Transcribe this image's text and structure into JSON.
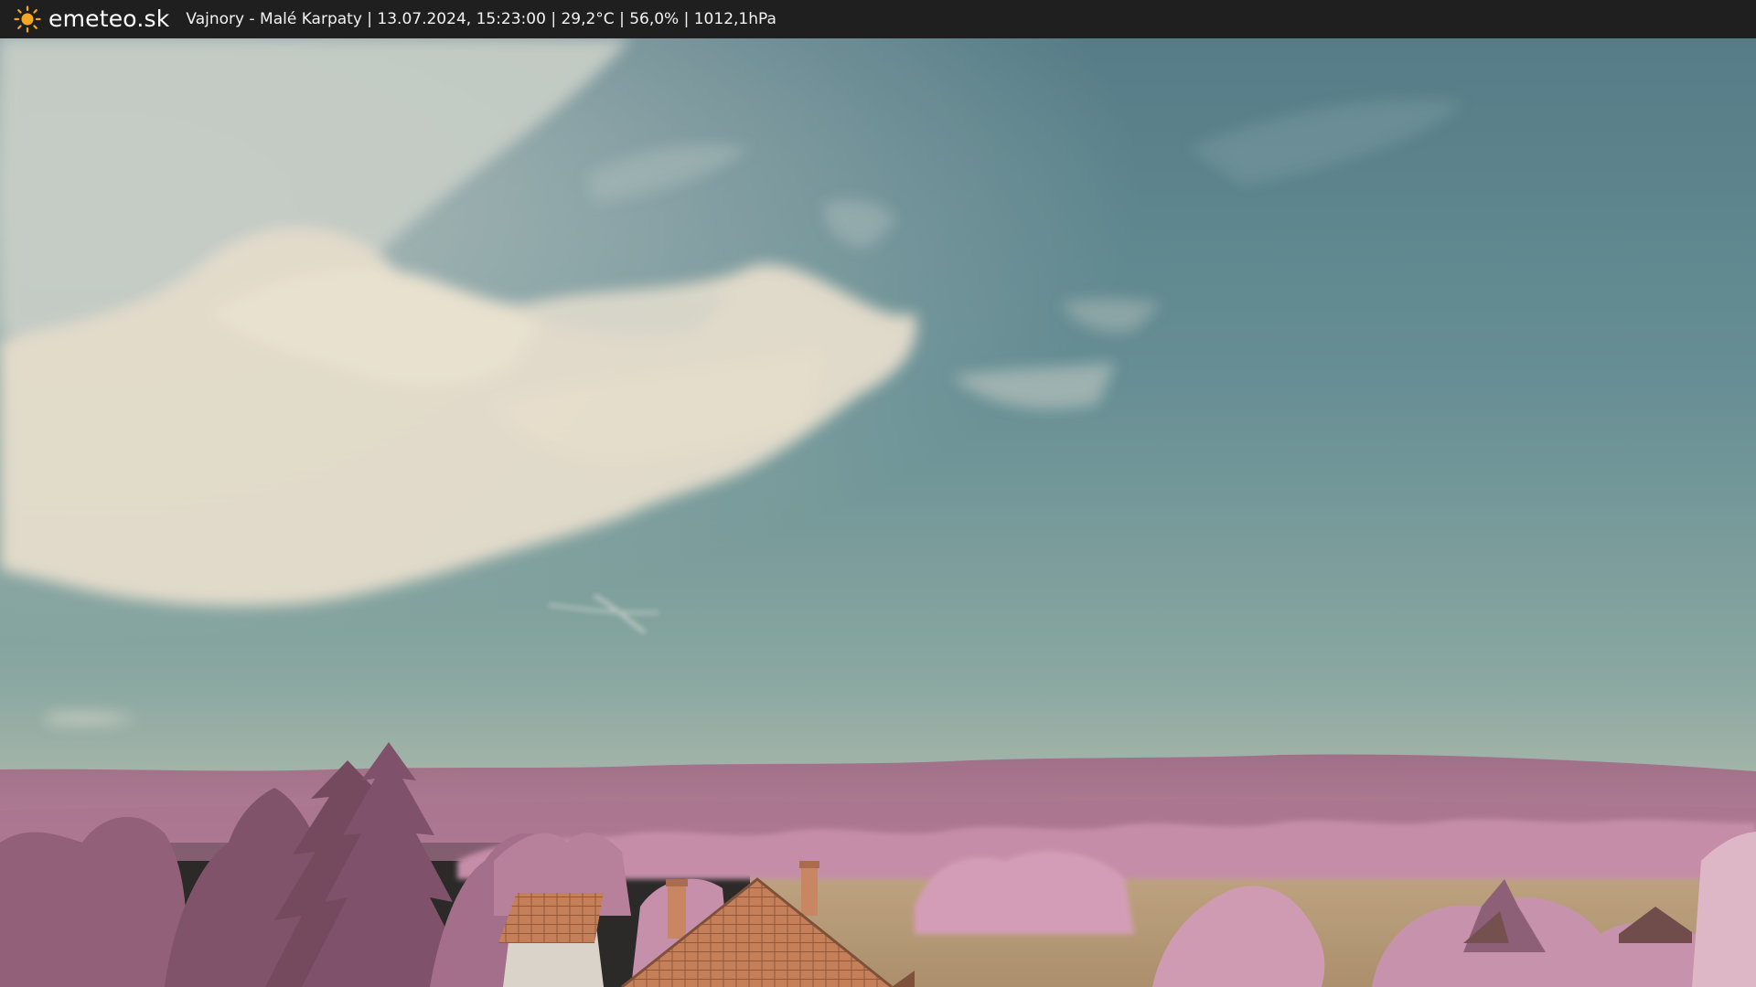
{
  "header": {
    "logo_icon": "sun-icon",
    "brand": "emeteo.sk",
    "caption": "Vajnory - Malé Karpaty | 13.07.2024, 15:23:00 | 29,2°C | 56,0% | 1012,1hPa"
  },
  "colors": {
    "bar": "#1f1f1f",
    "sun": "#f5a623",
    "sky_top": "#4f7c88",
    "sky_bottom": "#7fa2a0",
    "cloud": "#e6ddcc",
    "hills": "#9a6b84",
    "foliage": "#c98fae",
    "roof": "#c9774e",
    "field": "#b49a78"
  }
}
